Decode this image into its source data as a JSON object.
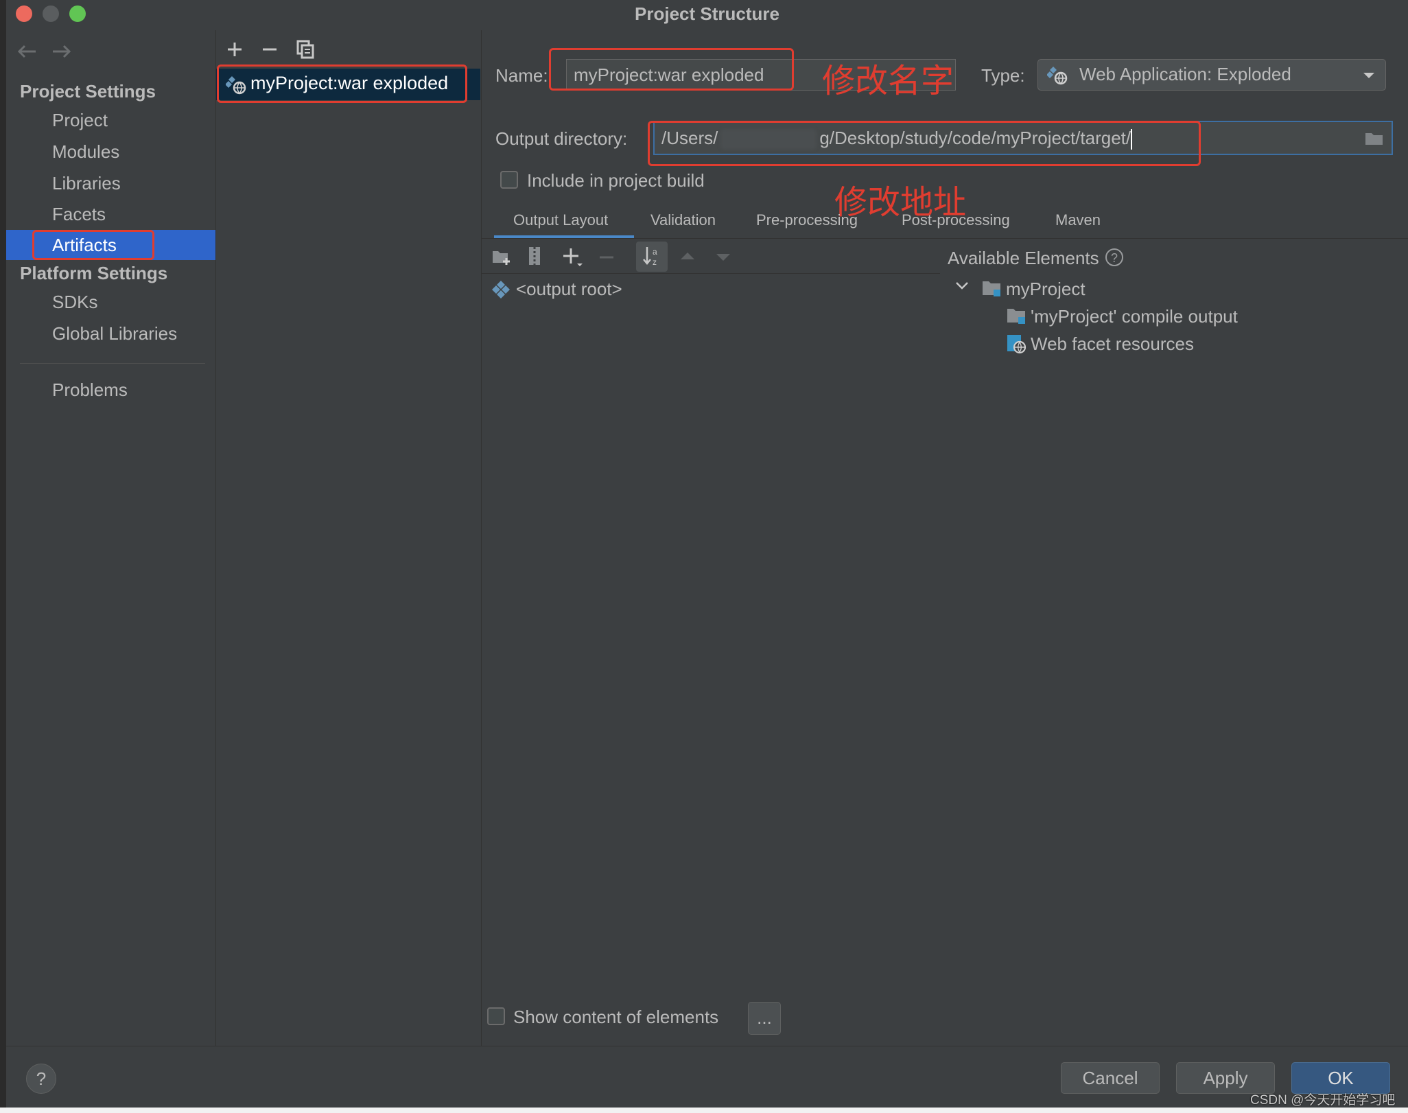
{
  "window": {
    "title": "Project Structure"
  },
  "nav": {
    "back_icon": "arrow-left-icon",
    "forward_icon": "arrow-right-icon"
  },
  "sidebar": {
    "project_settings_header": "Project Settings",
    "project_items": [
      {
        "label": "Project"
      },
      {
        "label": "Modules"
      },
      {
        "label": "Libraries"
      },
      {
        "label": "Facets"
      },
      {
        "label": "Artifacts",
        "selected": true
      }
    ],
    "platform_settings_header": "Platform Settings",
    "platform_items": [
      {
        "label": "SDKs"
      },
      {
        "label": "Global Libraries"
      }
    ],
    "problems_label": "Problems"
  },
  "artifacts_panel": {
    "toolbar": [
      "add-icon",
      "remove-icon",
      "copy-icon"
    ],
    "items": [
      {
        "label": "myProject:war exploded",
        "icon": "web-artifact-icon"
      }
    ]
  },
  "editor": {
    "name_label": "Name:",
    "name_value": "myProject:war exploded",
    "type_label": "Type:",
    "type_value": "Web Application: Exploded",
    "output_dir_label": "Output directory:",
    "output_dir_prefix": "/Users/",
    "output_dir_suffix": "g/Desktop/study/code/myProject/target/",
    "include_in_build_label": "Include in project build",
    "include_in_build_checked": false,
    "tabs": [
      {
        "label": "Output Layout",
        "active": true
      },
      {
        "label": "Validation"
      },
      {
        "label": "Pre-processing"
      },
      {
        "label": "Post-processing"
      },
      {
        "label": "Maven"
      }
    ],
    "layout_toolbar": [
      "new-directory-icon",
      "archive-icon",
      "add-icon",
      "remove-icon",
      "sort-icon",
      "move-up-icon",
      "move-down-icon"
    ],
    "output_root_label": "<output root>",
    "available_elements_label": "Available Elements",
    "available_tree": {
      "root": "myProject",
      "children": [
        "'myProject' compile output",
        "Web facet resources"
      ]
    },
    "show_content_label": "Show content of elements",
    "show_content_checked": false,
    "more_button_label": "..."
  },
  "annotations": {
    "rename_note": "修改名字",
    "path_note": "修改地址",
    "accent_color": "#e03d30"
  },
  "footer": {
    "help_label": "?",
    "cancel_label": "Cancel",
    "apply_label": "Apply",
    "ok_label": "OK",
    "watermark": "CSDN @今天开始学习吧"
  },
  "colors": {
    "background": "#3c3f41",
    "selection": "#2f65ca",
    "ok_button": "#365880"
  }
}
